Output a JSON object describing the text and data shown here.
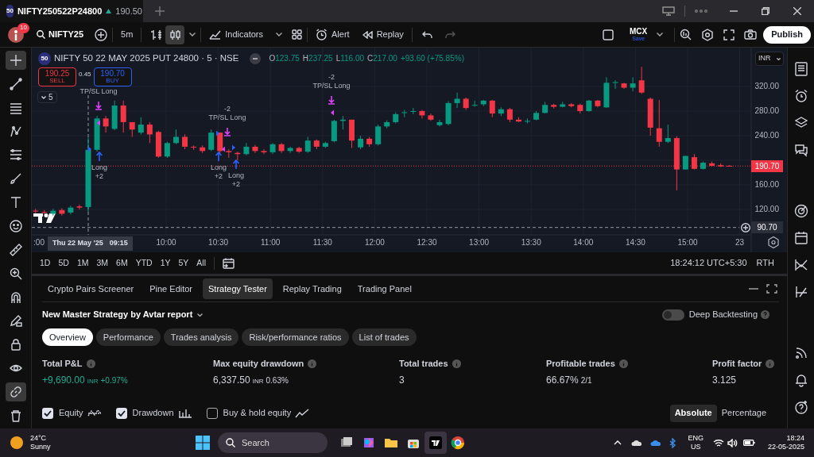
{
  "title_bar": {
    "tab": {
      "badge": "50",
      "title": "NIFTY250522P24800",
      "price": "190.50",
      "selected": true
    }
  },
  "toolbar": {
    "notifications": "10",
    "symbol": "NIFTY25",
    "interval": "5m",
    "chart_types": [
      {
        "kind": "bars",
        "selected": false
      },
      {
        "kind": "candles",
        "selected": true
      }
    ],
    "indicators": "Indicators",
    "alert": "Alert",
    "replay": "Replay",
    "undo": {
      "disabled": false
    },
    "redo": {
      "disabled": true
    },
    "layout": {
      "name": "MCX",
      "status": "Save"
    },
    "publish": "Publish"
  },
  "left_toolbar": [
    {
      "kind": "crosshair",
      "selected": true
    },
    {
      "kind": "line",
      "selected": false
    },
    {
      "kind": "lines",
      "selected": false
    },
    {
      "kind": "pattern",
      "selected": false
    },
    {
      "kind": "fib",
      "selected": false
    },
    {
      "kind": "brush",
      "selected": false
    },
    {
      "kind": "text",
      "selected": false
    },
    {
      "kind": "emoji",
      "selected": false
    },
    {
      "kind": "ruler",
      "selected": false
    },
    {
      "kind": "zoom",
      "selected": false
    },
    {
      "kind": "magnet",
      "selected": false
    },
    {
      "kind": "pencil-lock",
      "selected": false
    },
    {
      "kind": "lock",
      "selected": false
    },
    {
      "kind": "eye",
      "selected": false
    },
    {
      "kind": "link",
      "selected": true
    },
    {
      "kind": "trash",
      "selected": false
    }
  ],
  "chart": {
    "legend": {
      "badge": "50",
      "title": "NIFTY 50 22 MAY 2025 PUT 24800 · 5 · NSE",
      "ohlc": [
        {
          "key": "O",
          "value": "123.75"
        },
        {
          "key": "H",
          "value": "237.25"
        },
        {
          "key": "L",
          "value": "116.00"
        },
        {
          "key": "C",
          "value": "217.00"
        }
      ],
      "change": "+93.60 (+75.85%)"
    },
    "sell": {
      "price": "190.25",
      "label": "SELL"
    },
    "spread": "0.45",
    "buy": {
      "price": "190.70",
      "label": "BUY"
    },
    "indicator_count": "5",
    "currency": "INR",
    "time_axis": [
      ":00",
      "10:00",
      "10:30",
      "11:00",
      "11:30",
      "12:00",
      "12:30",
      "13:00",
      "13:30",
      "14:00",
      "14:30",
      "15:00",
      "23"
    ],
    "chart_data": {
      "type": "candlestick",
      "categories": [
        null,
        null,
        null,
        null,
        null,
        null,
        null,
        null,
        null,
        null,
        null,
        null,
        null,
        null,
        null,
        null,
        null,
        null,
        null,
        null,
        null,
        null,
        null,
        null,
        null,
        null,
        null,
        null,
        null,
        null,
        null,
        null,
        null,
        null,
        null,
        null,
        null,
        null,
        null,
        null,
        null,
        null,
        null,
        null,
        null,
        null,
        null,
        null,
        null,
        null,
        null,
        null,
        null,
        null,
        null,
        null,
        null,
        null,
        null,
        null,
        null,
        null,
        null,
        null,
        null,
        null,
        null,
        null,
        null,
        null,
        null,
        null,
        null,
        null,
        null,
        null,
        null,
        null,
        null,
        null
      ],
      "ylim": [
        78.7,
        383.2
      ],
      "grid": true,
      "ref_lines": [
        {
          "axis": "y",
          "value": 190.7,
          "label": "190.70",
          "color": "#f23645"
        },
        {
          "axis": "y",
          "value": 90.7,
          "label": "90.70",
          "color": "#9598a1"
        }
      ],
      "yticks": [
        {
          "value": 320,
          "label": "320.00"
        },
        {
          "value": 280,
          "label": "280.00"
        },
        {
          "value": 240,
          "label": "240.00"
        },
        {
          "value": 160,
          "label": "160.00"
        },
        {
          "value": 120,
          "label": "120.00"
        }
      ],
      "ohlc": [
        [
          118,
          121,
          114,
          117
        ],
        [
          116,
          119,
          112,
          115
        ],
        [
          113,
          121,
          110,
          118
        ],
        [
          119,
          122,
          110,
          113
        ],
        [
          115,
          126,
          112,
          123
        ],
        [
          125,
          128,
          120,
          123
        ],
        [
          124,
          237,
          116,
          217
        ],
        [
          217,
          272,
          214,
          268
        ],
        [
          268,
          272,
          245,
          255
        ],
        [
          251,
          297,
          249,
          289
        ],
        [
          289,
          297,
          245,
          262
        ],
        [
          262,
          262,
          238,
          250
        ],
        [
          245,
          270,
          242,
          258
        ],
        [
          258,
          262,
          228,
          242
        ],
        [
          246,
          248,
          204,
          206
        ],
        [
          206,
          230,
          204,
          228
        ],
        [
          228,
          250,
          226,
          238
        ],
        [
          238,
          242,
          218,
          222
        ],
        [
          222,
          224,
          217,
          221
        ],
        [
          221,
          224,
          212,
          215
        ],
        [
          217,
          250,
          215,
          245
        ],
        [
          245,
          245,
          210,
          215
        ],
        [
          215,
          218,
          204,
          213
        ],
        [
          212,
          214,
          200,
          210
        ],
        [
          210,
          228,
          208,
          222
        ],
        [
          222,
          225,
          212,
          215
        ],
        [
          215,
          218,
          210,
          213
        ],
        [
          213,
          228,
          210,
          226
        ],
        [
          226,
          228,
          212,
          215
        ],
        [
          215,
          222,
          212,
          220
        ],
        [
          220,
          222,
          212,
          214
        ],
        [
          214,
          238,
          212,
          232
        ],
        [
          232,
          234,
          218,
          222
        ],
        [
          222,
          230,
          220,
          228
        ],
        [
          231,
          266,
          229,
          264
        ],
        [
          264,
          272,
          250,
          266
        ],
        [
          266,
          266,
          220,
          232
        ],
        [
          221,
          240,
          218,
          235
        ],
        [
          235,
          238,
          222,
          226
        ],
        [
          226,
          258,
          224,
          255
        ],
        [
          255,
          265,
          252,
          262
        ],
        [
          262,
          278,
          260,
          275
        ],
        [
          278,
          282,
          270,
          278
        ],
        [
          280,
          285,
          275,
          280
        ],
        [
          280,
          282,
          268,
          273
        ],
        [
          273,
          276,
          264,
          266
        ],
        [
          257,
          266,
          255,
          262
        ],
        [
          259,
          296,
          257,
          293
        ],
        [
          293,
          310,
          285,
          300
        ],
        [
          300,
          302,
          282,
          285
        ],
        [
          289,
          297,
          287,
          290
        ],
        [
          291,
          298,
          288,
          297
        ],
        [
          297,
          298,
          270,
          276
        ],
        [
          276,
          286,
          272,
          283
        ],
        [
          283,
          285,
          262,
          266
        ],
        [
          266,
          270,
          262,
          263
        ],
        [
          263,
          268,
          260,
          264
        ],
        [
          266,
          280,
          265,
          277
        ],
        [
          277,
          295,
          276,
          290
        ],
        [
          290,
          292,
          284,
          287
        ],
        [
          287,
          295,
          286,
          291
        ],
        [
          291,
          293,
          286,
          288
        ],
        [
          290,
          292,
          276,
          280
        ],
        [
          280,
          298,
          279,
          297
        ],
        [
          297,
          298,
          286,
          288
        ],
        [
          286,
          335,
          285,
          326
        ],
        [
          327,
          330,
          316,
          327
        ],
        [
          325,
          326,
          316,
          318
        ],
        [
          318,
          335,
          312,
          325
        ],
        [
          330,
          352,
          308,
          310
        ],
        [
          300,
          302,
          240,
          253
        ],
        [
          252,
          298,
          222,
          230
        ],
        [
          230,
          258,
          228,
          236
        ],
        [
          236,
          239,
          151,
          185
        ],
        [
          185,
          207,
          185,
          207
        ],
        [
          205,
          210,
          185,
          186
        ],
        [
          186,
          198,
          185,
          196
        ],
        [
          195,
          198,
          190,
          191
        ],
        [
          192,
          195,
          189,
          190
        ],
        [
          191,
          192,
          190,
          190.7
        ]
      ]
    },
    "crosshair_date": "Thu 22 May '25",
    "crosshair_time": "09:15",
    "trade_marks": [
      {
        "kind": "exit",
        "lines": [
          "TP/SL Long"
        ]
      },
      {
        "kind": "exit",
        "lines": [
          "-2",
          "TP/SL Long"
        ]
      },
      {
        "kind": "exit",
        "lines": [
          "-2",
          "TP/SL Long"
        ]
      },
      {
        "kind": "entry",
        "lines": [
          "Long",
          "+2"
        ]
      },
      {
        "kind": "entry",
        "lines": [
          "Long",
          "+2"
        ]
      },
      {
        "kind": "entry",
        "lines": [
          "Long",
          "+2"
        ]
      }
    ]
  },
  "range_bar": {
    "ranges": [
      "1D",
      "5D",
      "1M",
      "3M",
      "6M",
      "YTD",
      "1Y",
      "5Y",
      "All"
    ],
    "clock": "18:24:12 UTC+5:30",
    "session": "RTH"
  },
  "panel": {
    "tabs": [
      {
        "label": "Crypto Pairs Screener",
        "selected": false
      },
      {
        "label": "Pine Editor",
        "selected": false
      },
      {
        "label": "Strategy Tester",
        "selected": true
      },
      {
        "label": "Replay Trading",
        "selected": false
      },
      {
        "label": "Trading Panel",
        "selected": false
      }
    ],
    "strategy": "New Master Strategy by Avtar report",
    "deep_backtesting": {
      "label": "Deep Backtesting",
      "on": false
    },
    "subtabs": [
      {
        "label": "Overview",
        "selected": true
      },
      {
        "label": "Performance",
        "selected": false
      },
      {
        "label": "Trades analysis",
        "selected": false
      },
      {
        "label": "Risk/performance ratios",
        "selected": false
      },
      {
        "label": "List of trades",
        "selected": false
      }
    ],
    "metrics": [
      {
        "label": "Total P&L",
        "value": "+9,690.00",
        "unit": "INR",
        "extra": "+0.97%",
        "profit": true
      },
      {
        "label": "Max equity drawdown",
        "value": "6,337.50",
        "unit": "INR",
        "extra": "0.63%",
        "profit": false
      },
      {
        "label": "Total trades",
        "value": "3",
        "profit": false
      },
      {
        "label": "Profitable trades",
        "value": "66.67%",
        "extra": "2/1",
        "profit": false
      },
      {
        "label": "Profit factor",
        "value": "3.125",
        "profit": false
      }
    ],
    "series_toggles": [
      {
        "kind": "equity",
        "label": "Equity",
        "checked": true
      },
      {
        "kind": "drawdown",
        "label": "Drawdown",
        "checked": true
      },
      {
        "kind": "buy_hold",
        "label": "Buy & hold equity",
        "checked": false
      }
    ],
    "modes": [
      {
        "label": "Absolute",
        "selected": true
      },
      {
        "label": "Percentage",
        "selected": false
      }
    ]
  },
  "taskbar": {
    "weather": {
      "temp": "24°C",
      "text": "Sunny"
    },
    "search": {
      "placeholder": "Search"
    },
    "language": [
      "ENG",
      "US"
    ],
    "time": "18:24",
    "date": "22-05-2025"
  }
}
